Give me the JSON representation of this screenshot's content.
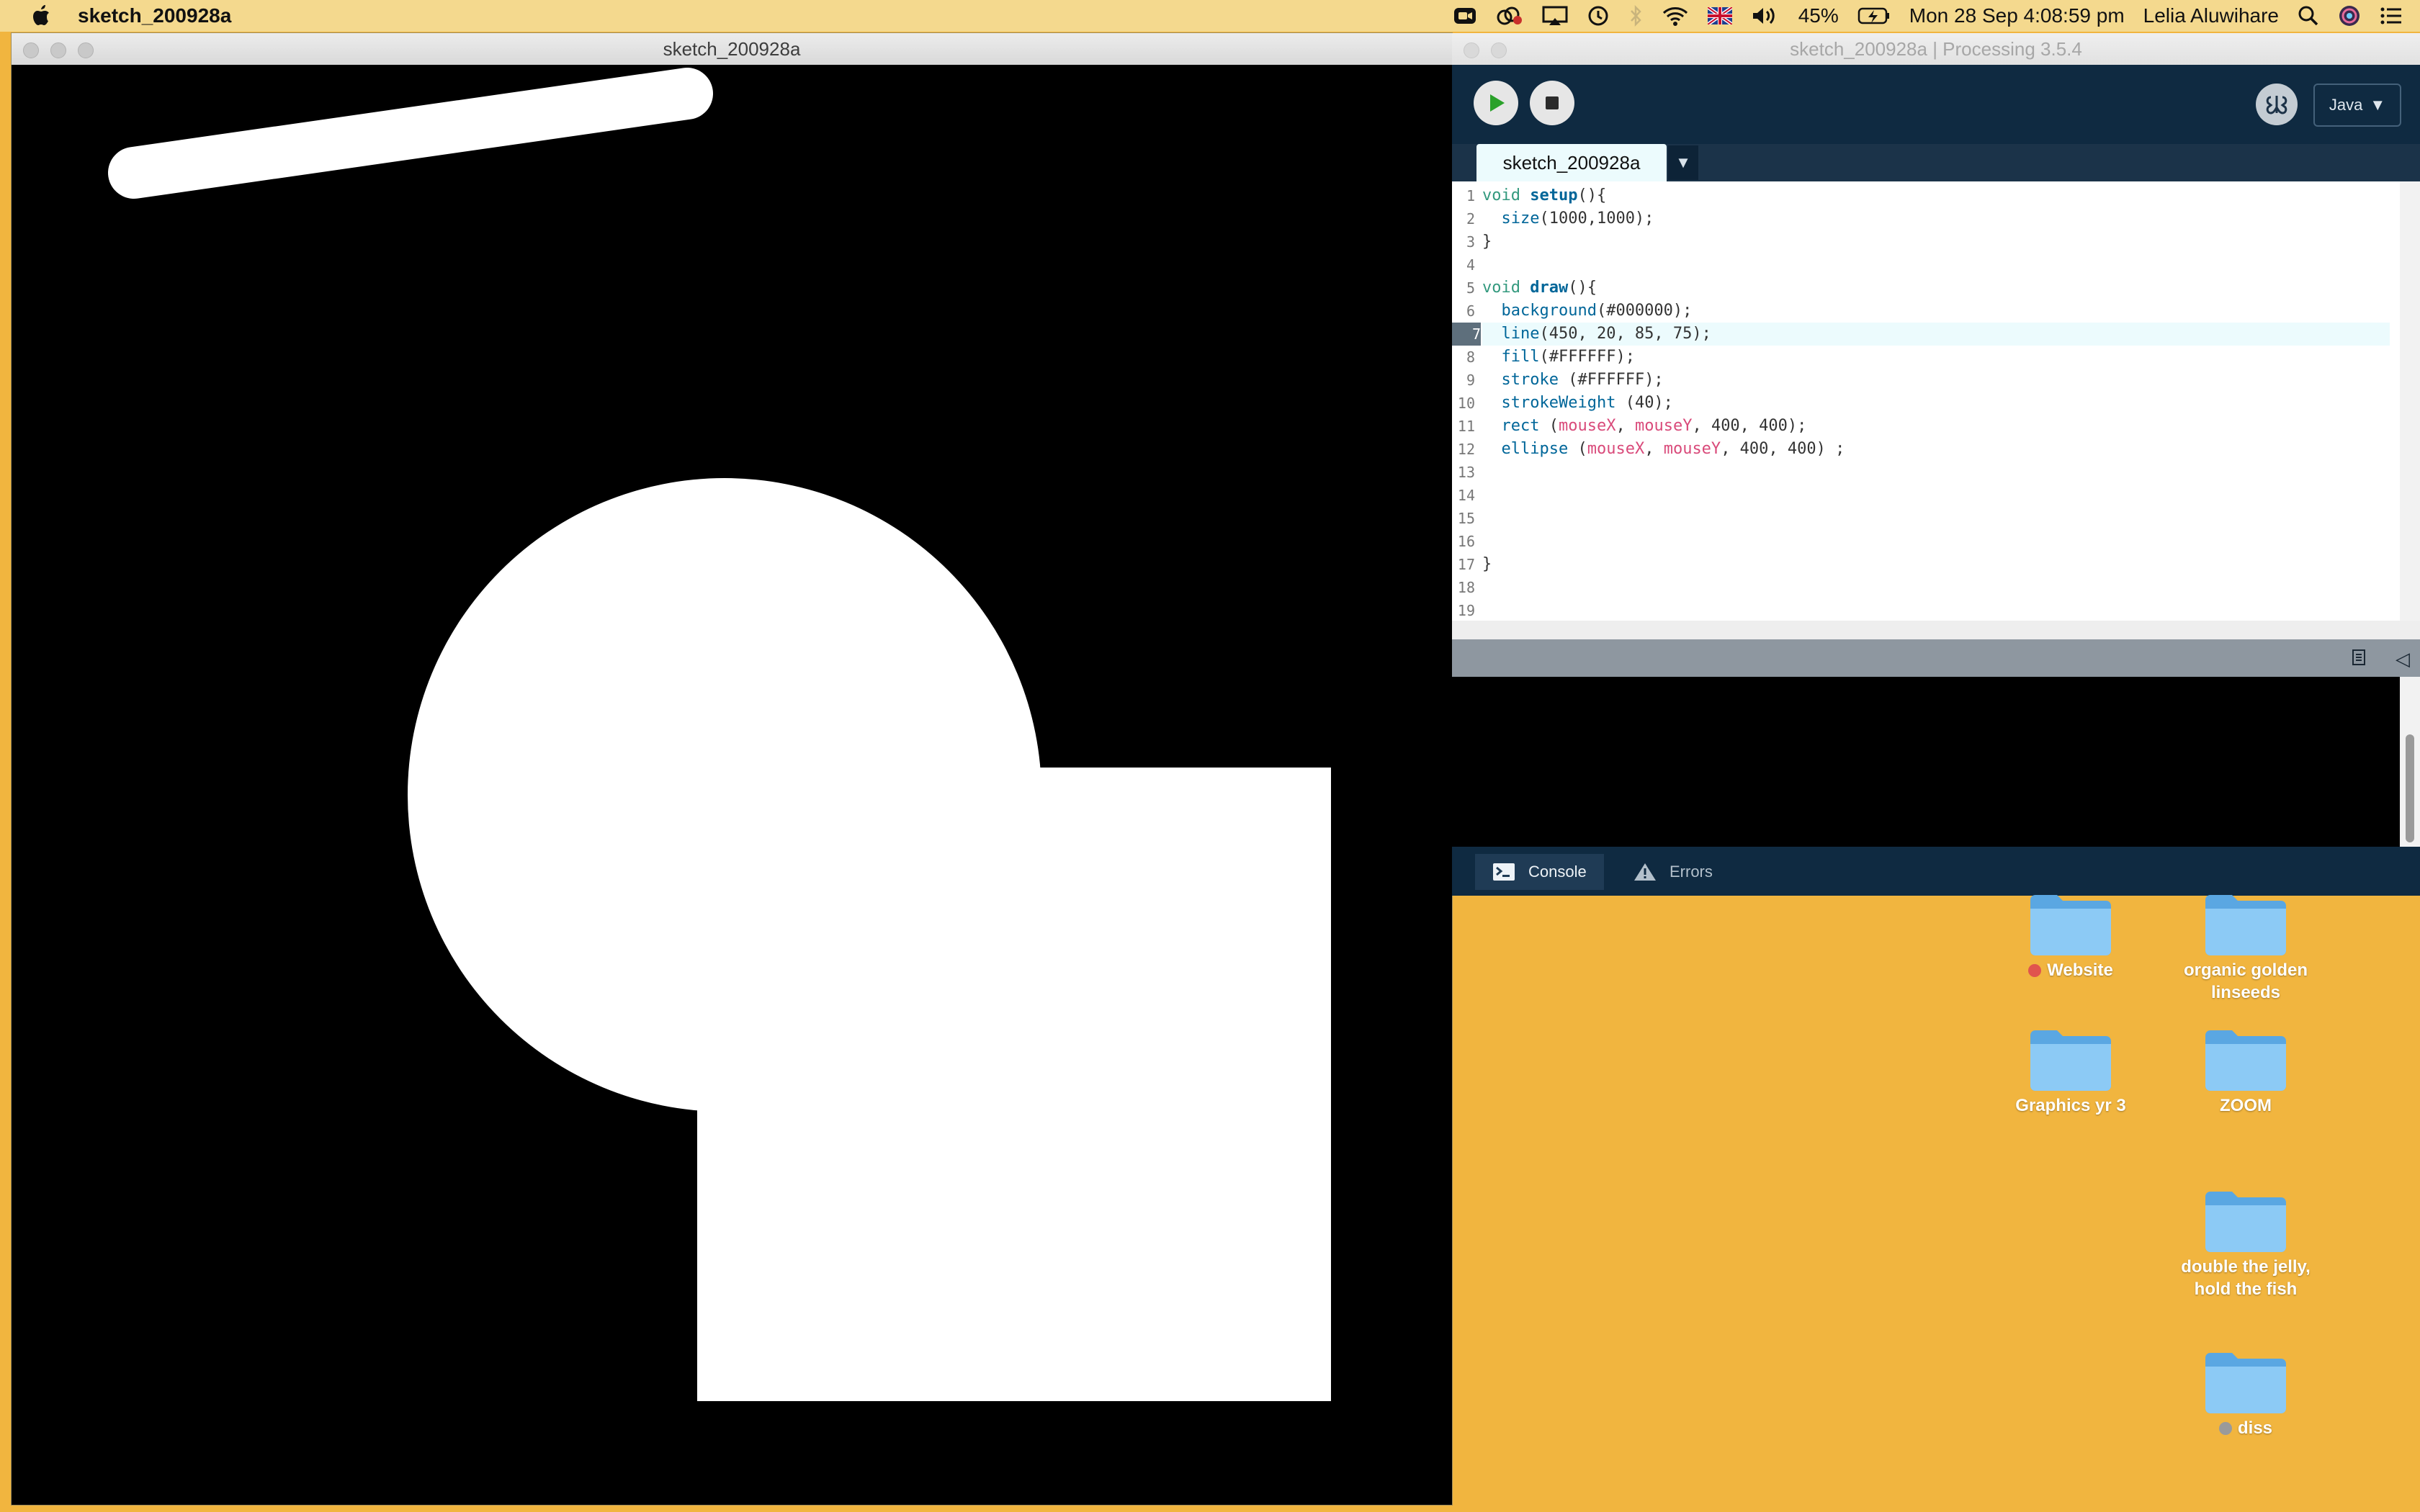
{
  "menubar": {
    "app_name": "sketch_200928a",
    "battery": "45%",
    "date_time": "Mon 28 Sep  4:08:59 pm",
    "user": "Lelia Aluwihare"
  },
  "sketch_window": {
    "title": "sketch_200928a"
  },
  "ide": {
    "title": "sketch_200928a | Processing 3.5.4",
    "mode": "Java",
    "tab": "sketch_200928a",
    "code_lines": [
      "void setup(){",
      "  size(1000,1000);",
      "}",
      "",
      "void draw(){",
      "  background(#000000);",
      "  line(450, 20, 85, 75);",
      "  fill(#FFFFFF);",
      "  stroke (#FFFFFF);",
      "  strokeWeight (40);",
      "  rect (mouseX, mouseY, 400, 400);",
      "  ellipse (mouseX, mouseY, 400, 400) ;",
      "",
      "",
      "",
      "",
      "}",
      "",
      ""
    ],
    "line_numbers": [
      "1",
      "2",
      "3",
      "4",
      "5",
      "6",
      "7",
      "8",
      "9",
      "10",
      "11",
      "12",
      "13",
      "14",
      "15",
      "16",
      "17",
      "18",
      "19"
    ],
    "current_line": 7,
    "console_tab": "Console",
    "errors_tab": "Errors"
  },
  "desktop": {
    "icons": [
      {
        "label": "Website",
        "tag_color": "#e0544e"
      },
      {
        "label": "organic golden linseeds",
        "tag_color": ""
      },
      {
        "label": "Graphics yr 3",
        "tag_color": ""
      },
      {
        "label": "ZOOM",
        "tag_color": ""
      },
      {
        "label": "double the jelly, hold the fish",
        "tag_color": ""
      },
      {
        "label": "diss",
        "tag_color": "#9a9a9a"
      }
    ]
  },
  "colors": {
    "desktop": "#f1b53f",
    "menubar": "#f4d98e",
    "sketch_background": "#000000",
    "sketch_fill": "#FFFFFF",
    "ide_dark": "#0f2a41"
  }
}
